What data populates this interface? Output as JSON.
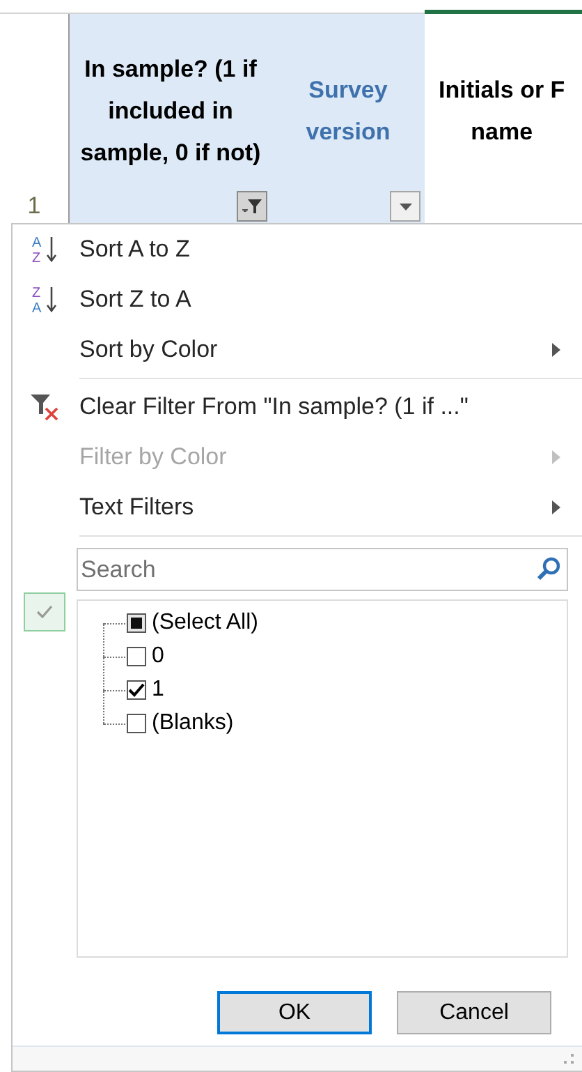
{
  "row_header": {
    "label": "1"
  },
  "columns": [
    {
      "header": "In sample? (1 if included in sample, 0 if not)",
      "highlighted": true,
      "kind": "plain",
      "has_filter_button": true,
      "filtered": true
    },
    {
      "header": "Survey version",
      "highlighted": true,
      "kind": "link",
      "has_filter_button": true,
      "filtered": false
    },
    {
      "header": "Initials or F\nname",
      "highlighted": false,
      "kind": "plain",
      "has_filter_button": false,
      "filtered": false
    }
  ],
  "menu": {
    "items": [
      {
        "kind": "sort-az",
        "icon_letters": [
          "A",
          "Z"
        ],
        "label": "Sort A to Z",
        "submenu": false,
        "disabled": false
      },
      {
        "kind": "sort-za",
        "icon_letters": [
          "Z",
          "A"
        ],
        "label": "Sort Z to A",
        "submenu": false,
        "disabled": false
      },
      {
        "kind": "plain",
        "label": "Sort by Color",
        "submenu": true,
        "disabled": false
      },
      {
        "kind": "separator"
      },
      {
        "kind": "clear-filter",
        "label": "Clear Filter From \"In sample? (1 if ...\"",
        "submenu": false,
        "disabled": false
      },
      {
        "kind": "plain",
        "label": "Filter by Color",
        "submenu": true,
        "disabled": true
      },
      {
        "kind": "plain",
        "label": "Text Filters",
        "submenu": true,
        "disabled": false
      },
      {
        "kind": "separator"
      }
    ],
    "search": {
      "placeholder": "Search"
    },
    "values": [
      {
        "label": "(Select All)",
        "checked": false,
        "indeterminate": true
      },
      {
        "label": "0",
        "checked": false,
        "indeterminate": false
      },
      {
        "label": "1",
        "checked": true,
        "indeterminate": false
      },
      {
        "label": "(Blanks)",
        "checked": false,
        "indeterminate": false
      }
    ],
    "buttons": [
      {
        "label": "OK",
        "default": true
      },
      {
        "label": "Cancel",
        "default": false
      }
    ]
  }
}
